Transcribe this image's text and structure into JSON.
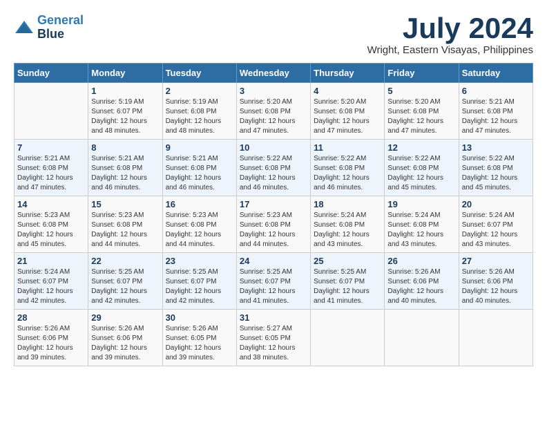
{
  "logo": {
    "line1": "General",
    "line2": "Blue"
  },
  "title": "July 2024",
  "location": "Wright, Eastern Visayas, Philippines",
  "headers": [
    "Sunday",
    "Monday",
    "Tuesday",
    "Wednesday",
    "Thursday",
    "Friday",
    "Saturday"
  ],
  "weeks": [
    [
      {
        "num": "",
        "sunrise": "",
        "sunset": "",
        "daylight": ""
      },
      {
        "num": "1",
        "sunrise": "Sunrise: 5:19 AM",
        "sunset": "Sunset: 6:07 PM",
        "daylight": "Daylight: 12 hours and 48 minutes."
      },
      {
        "num": "2",
        "sunrise": "Sunrise: 5:19 AM",
        "sunset": "Sunset: 6:08 PM",
        "daylight": "Daylight: 12 hours and 48 minutes."
      },
      {
        "num": "3",
        "sunrise": "Sunrise: 5:20 AM",
        "sunset": "Sunset: 6:08 PM",
        "daylight": "Daylight: 12 hours and 47 minutes."
      },
      {
        "num": "4",
        "sunrise": "Sunrise: 5:20 AM",
        "sunset": "Sunset: 6:08 PM",
        "daylight": "Daylight: 12 hours and 47 minutes."
      },
      {
        "num": "5",
        "sunrise": "Sunrise: 5:20 AM",
        "sunset": "Sunset: 6:08 PM",
        "daylight": "Daylight: 12 hours and 47 minutes."
      },
      {
        "num": "6",
        "sunrise": "Sunrise: 5:21 AM",
        "sunset": "Sunset: 6:08 PM",
        "daylight": "Daylight: 12 hours and 47 minutes."
      }
    ],
    [
      {
        "num": "7",
        "sunrise": "Sunrise: 5:21 AM",
        "sunset": "Sunset: 6:08 PM",
        "daylight": "Daylight: 12 hours and 47 minutes."
      },
      {
        "num": "8",
        "sunrise": "Sunrise: 5:21 AM",
        "sunset": "Sunset: 6:08 PM",
        "daylight": "Daylight: 12 hours and 46 minutes."
      },
      {
        "num": "9",
        "sunrise": "Sunrise: 5:21 AM",
        "sunset": "Sunset: 6:08 PM",
        "daylight": "Daylight: 12 hours and 46 minutes."
      },
      {
        "num": "10",
        "sunrise": "Sunrise: 5:22 AM",
        "sunset": "Sunset: 6:08 PM",
        "daylight": "Daylight: 12 hours and 46 minutes."
      },
      {
        "num": "11",
        "sunrise": "Sunrise: 5:22 AM",
        "sunset": "Sunset: 6:08 PM",
        "daylight": "Daylight: 12 hours and 46 minutes."
      },
      {
        "num": "12",
        "sunrise": "Sunrise: 5:22 AM",
        "sunset": "Sunset: 6:08 PM",
        "daylight": "Daylight: 12 hours and 45 minutes."
      },
      {
        "num": "13",
        "sunrise": "Sunrise: 5:22 AM",
        "sunset": "Sunset: 6:08 PM",
        "daylight": "Daylight: 12 hours and 45 minutes."
      }
    ],
    [
      {
        "num": "14",
        "sunrise": "Sunrise: 5:23 AM",
        "sunset": "Sunset: 6:08 PM",
        "daylight": "Daylight: 12 hours and 45 minutes."
      },
      {
        "num": "15",
        "sunrise": "Sunrise: 5:23 AM",
        "sunset": "Sunset: 6:08 PM",
        "daylight": "Daylight: 12 hours and 44 minutes."
      },
      {
        "num": "16",
        "sunrise": "Sunrise: 5:23 AM",
        "sunset": "Sunset: 6:08 PM",
        "daylight": "Daylight: 12 hours and 44 minutes."
      },
      {
        "num": "17",
        "sunrise": "Sunrise: 5:23 AM",
        "sunset": "Sunset: 6:08 PM",
        "daylight": "Daylight: 12 hours and 44 minutes."
      },
      {
        "num": "18",
        "sunrise": "Sunrise: 5:24 AM",
        "sunset": "Sunset: 6:08 PM",
        "daylight": "Daylight: 12 hours and 43 minutes."
      },
      {
        "num": "19",
        "sunrise": "Sunrise: 5:24 AM",
        "sunset": "Sunset: 6:08 PM",
        "daylight": "Daylight: 12 hours and 43 minutes."
      },
      {
        "num": "20",
        "sunrise": "Sunrise: 5:24 AM",
        "sunset": "Sunset: 6:07 PM",
        "daylight": "Daylight: 12 hours and 43 minutes."
      }
    ],
    [
      {
        "num": "21",
        "sunrise": "Sunrise: 5:24 AM",
        "sunset": "Sunset: 6:07 PM",
        "daylight": "Daylight: 12 hours and 42 minutes."
      },
      {
        "num": "22",
        "sunrise": "Sunrise: 5:25 AM",
        "sunset": "Sunset: 6:07 PM",
        "daylight": "Daylight: 12 hours and 42 minutes."
      },
      {
        "num": "23",
        "sunrise": "Sunrise: 5:25 AM",
        "sunset": "Sunset: 6:07 PM",
        "daylight": "Daylight: 12 hours and 42 minutes."
      },
      {
        "num": "24",
        "sunrise": "Sunrise: 5:25 AM",
        "sunset": "Sunset: 6:07 PM",
        "daylight": "Daylight: 12 hours and 41 minutes."
      },
      {
        "num": "25",
        "sunrise": "Sunrise: 5:25 AM",
        "sunset": "Sunset: 6:07 PM",
        "daylight": "Daylight: 12 hours and 41 minutes."
      },
      {
        "num": "26",
        "sunrise": "Sunrise: 5:26 AM",
        "sunset": "Sunset: 6:06 PM",
        "daylight": "Daylight: 12 hours and 40 minutes."
      },
      {
        "num": "27",
        "sunrise": "Sunrise: 5:26 AM",
        "sunset": "Sunset: 6:06 PM",
        "daylight": "Daylight: 12 hours and 40 minutes."
      }
    ],
    [
      {
        "num": "28",
        "sunrise": "Sunrise: 5:26 AM",
        "sunset": "Sunset: 6:06 PM",
        "daylight": "Daylight: 12 hours and 39 minutes."
      },
      {
        "num": "29",
        "sunrise": "Sunrise: 5:26 AM",
        "sunset": "Sunset: 6:06 PM",
        "daylight": "Daylight: 12 hours and 39 minutes."
      },
      {
        "num": "30",
        "sunrise": "Sunrise: 5:26 AM",
        "sunset": "Sunset: 6:05 PM",
        "daylight": "Daylight: 12 hours and 39 minutes."
      },
      {
        "num": "31",
        "sunrise": "Sunrise: 5:27 AM",
        "sunset": "Sunset: 6:05 PM",
        "daylight": "Daylight: 12 hours and 38 minutes."
      },
      {
        "num": "",
        "sunrise": "",
        "sunset": "",
        "daylight": ""
      },
      {
        "num": "",
        "sunrise": "",
        "sunset": "",
        "daylight": ""
      },
      {
        "num": "",
        "sunrise": "",
        "sunset": "",
        "daylight": ""
      }
    ]
  ]
}
